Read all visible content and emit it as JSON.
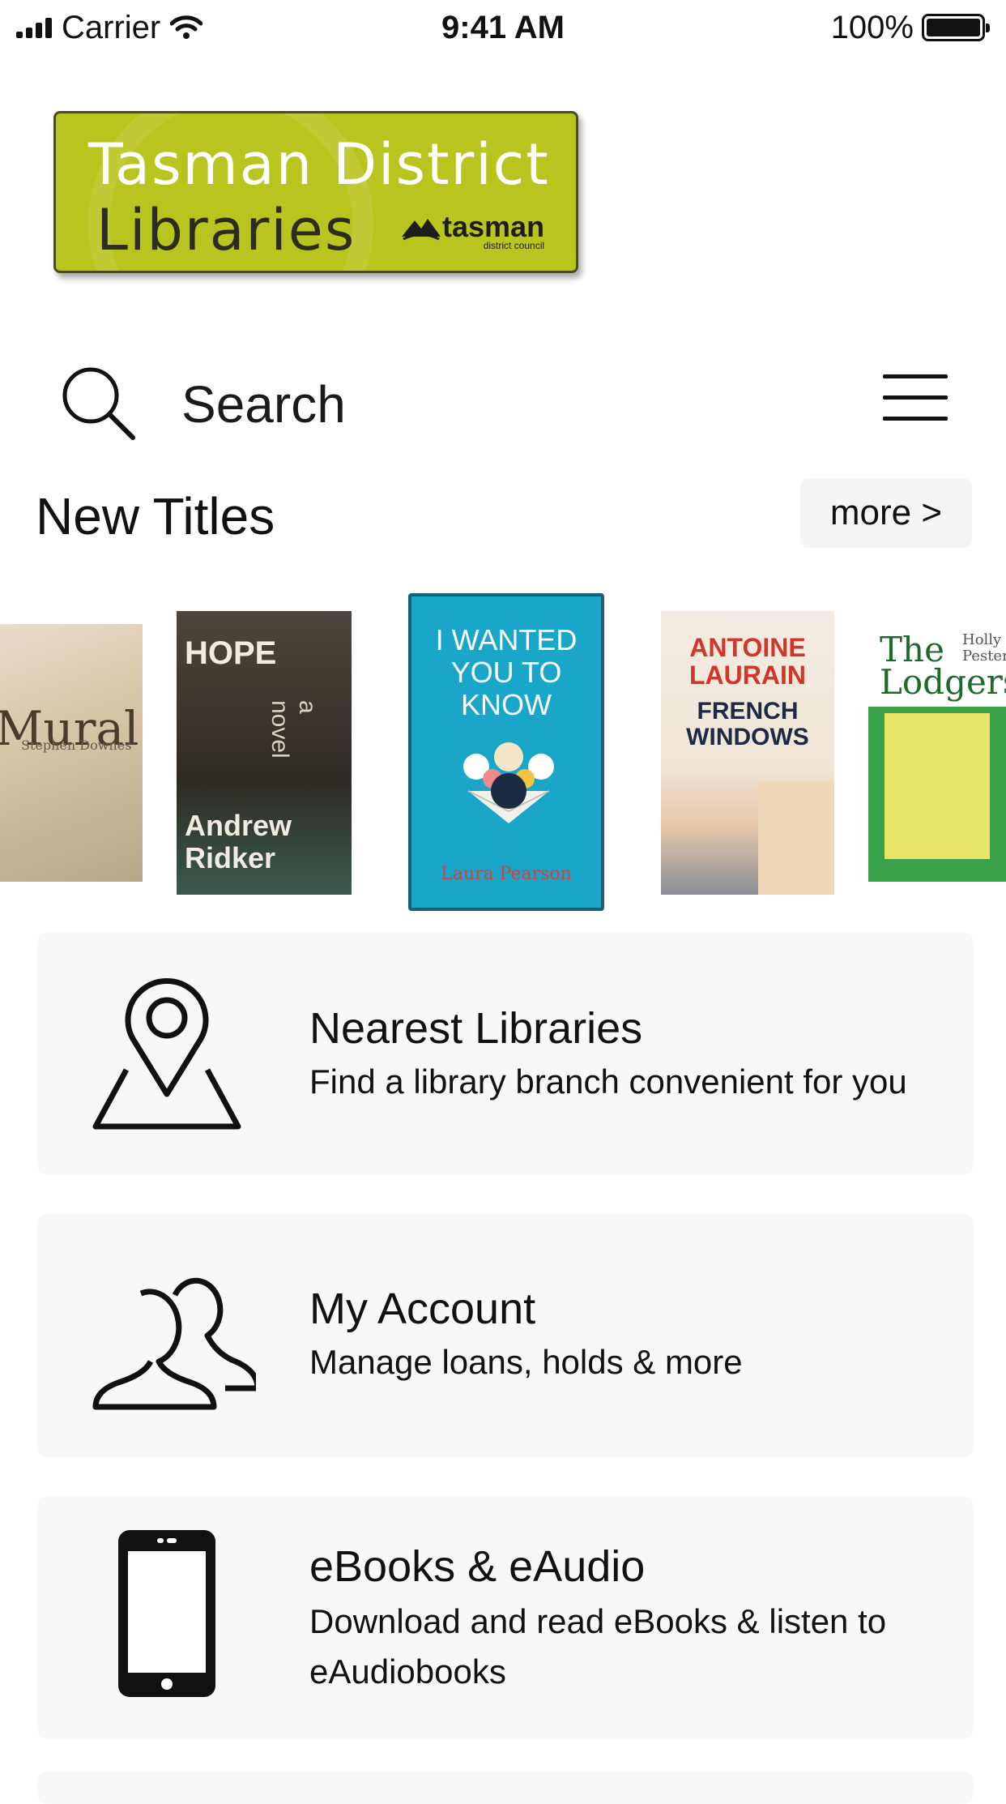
{
  "status_bar": {
    "carrier": "Carrier",
    "time": "9:41 AM",
    "battery": "100%"
  },
  "logo": {
    "line1": "Tasman District",
    "line2": "Libraries",
    "council_name": "tasman",
    "council_sub": "district council",
    "color": "#b8c51f"
  },
  "search": {
    "label": "Search"
  },
  "new_titles": {
    "heading": "New Titles",
    "more_label": "more >",
    "covers": [
      {
        "title": "Mural",
        "author": "Stephen Downes"
      },
      {
        "title": "HOPE",
        "author": "Andrew Ridker",
        "tagline": "a novel"
      },
      {
        "title": "I WANTED YOU TO KNOW",
        "author": "Laura Pearson"
      },
      {
        "title_line1": "ANTOINE LAURAIN",
        "title_line2": "FRENCH WINDOWS"
      },
      {
        "title": "The Lodgers",
        "author": "Holly Pester"
      }
    ]
  },
  "cards": [
    {
      "title": "Nearest Libraries",
      "subtitle": "Find a library branch convenient for you",
      "icon": "map-pin-icon"
    },
    {
      "title": "My Account",
      "subtitle": "Manage loans, holds & more",
      "icon": "users-icon"
    },
    {
      "title": "eBooks & eAudio",
      "subtitle": "Download and read eBooks & listen to eAudiobooks",
      "icon": "phone-icon"
    }
  ]
}
